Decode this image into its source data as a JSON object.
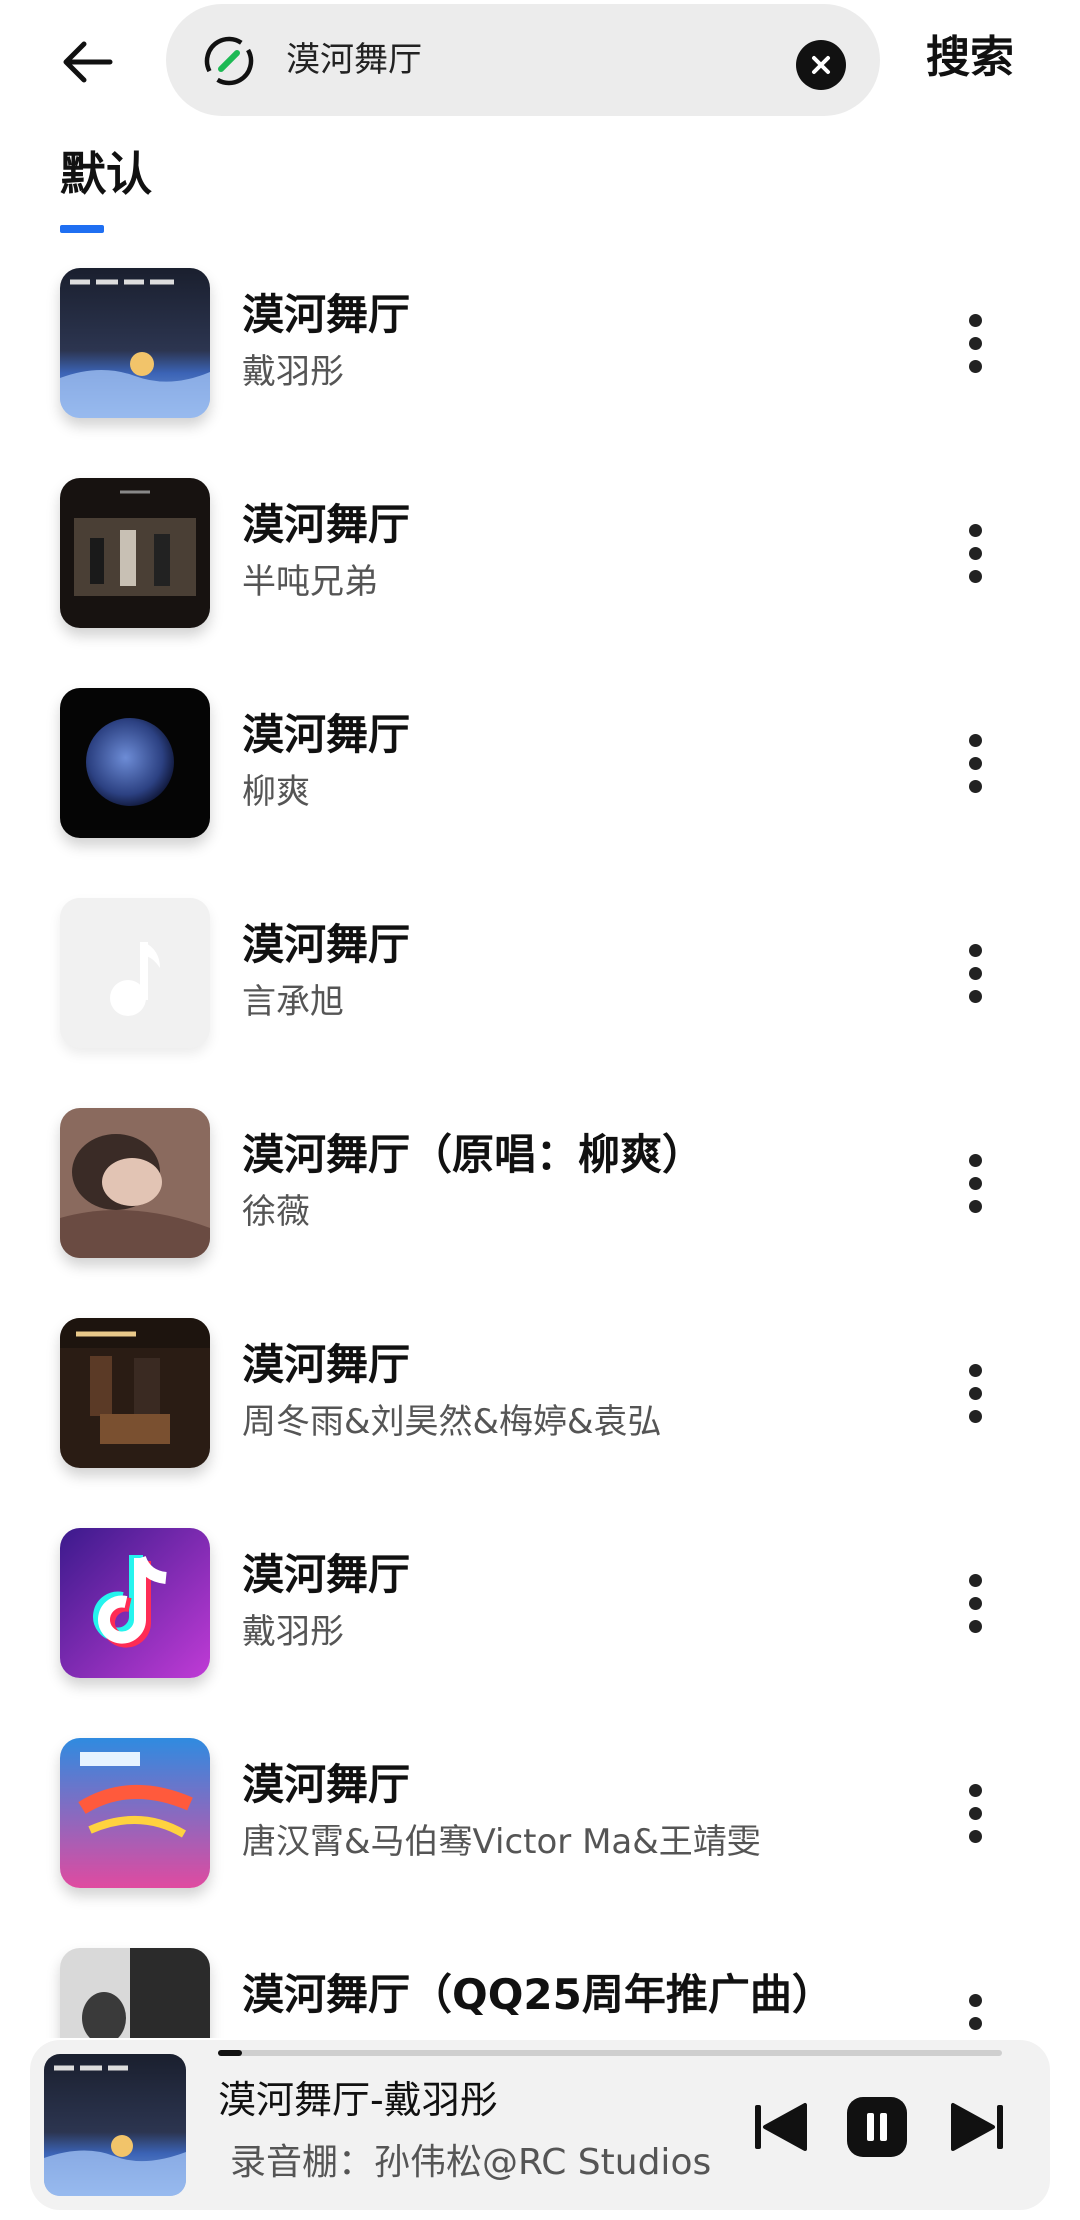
{
  "search": {
    "query": "漠河舞厅",
    "submit_label": "搜索"
  },
  "tabs": [
    {
      "label": "默认",
      "active": true
    }
  ],
  "songs": [
    {
      "title": "漠河舞厅",
      "artist": "戴羽彤"
    },
    {
      "title": "漠河舞厅",
      "artist": "半吨兄弟"
    },
    {
      "title": "漠河舞厅",
      "artist": "柳爽"
    },
    {
      "title": "漠河舞厅",
      "artist": "言承旭"
    },
    {
      "title": "漠河舞厅（原唱：柳爽）",
      "artist": "徐薇"
    },
    {
      "title": "漠河舞厅",
      "artist": "周冬雨&刘昊然&梅婷&袁弘"
    },
    {
      "title": "漠河舞厅",
      "artist": "戴羽彤"
    },
    {
      "title": "漠河舞厅",
      "artist": "唐汉霄&马伯骞Victor Ma&王靖雯"
    },
    {
      "title": "漠河舞厅（QQ25周年推广曲）",
      "artist": ""
    }
  ],
  "player": {
    "now_playing": "漠河舞厅-戴羽彤",
    "subtitle": "录音棚：孙伟松@RC Studios",
    "progress": 0.03
  },
  "icons": {
    "back": "back-arrow-icon",
    "search_logo": "link-logo-icon",
    "clear": "clear-icon",
    "more": "more-vertical-icon",
    "prev": "skip-previous-icon",
    "pause": "pause-icon",
    "next": "skip-next-icon"
  },
  "colors": {
    "accent": "#1f6ff2",
    "logo_green": "#1db954"
  }
}
